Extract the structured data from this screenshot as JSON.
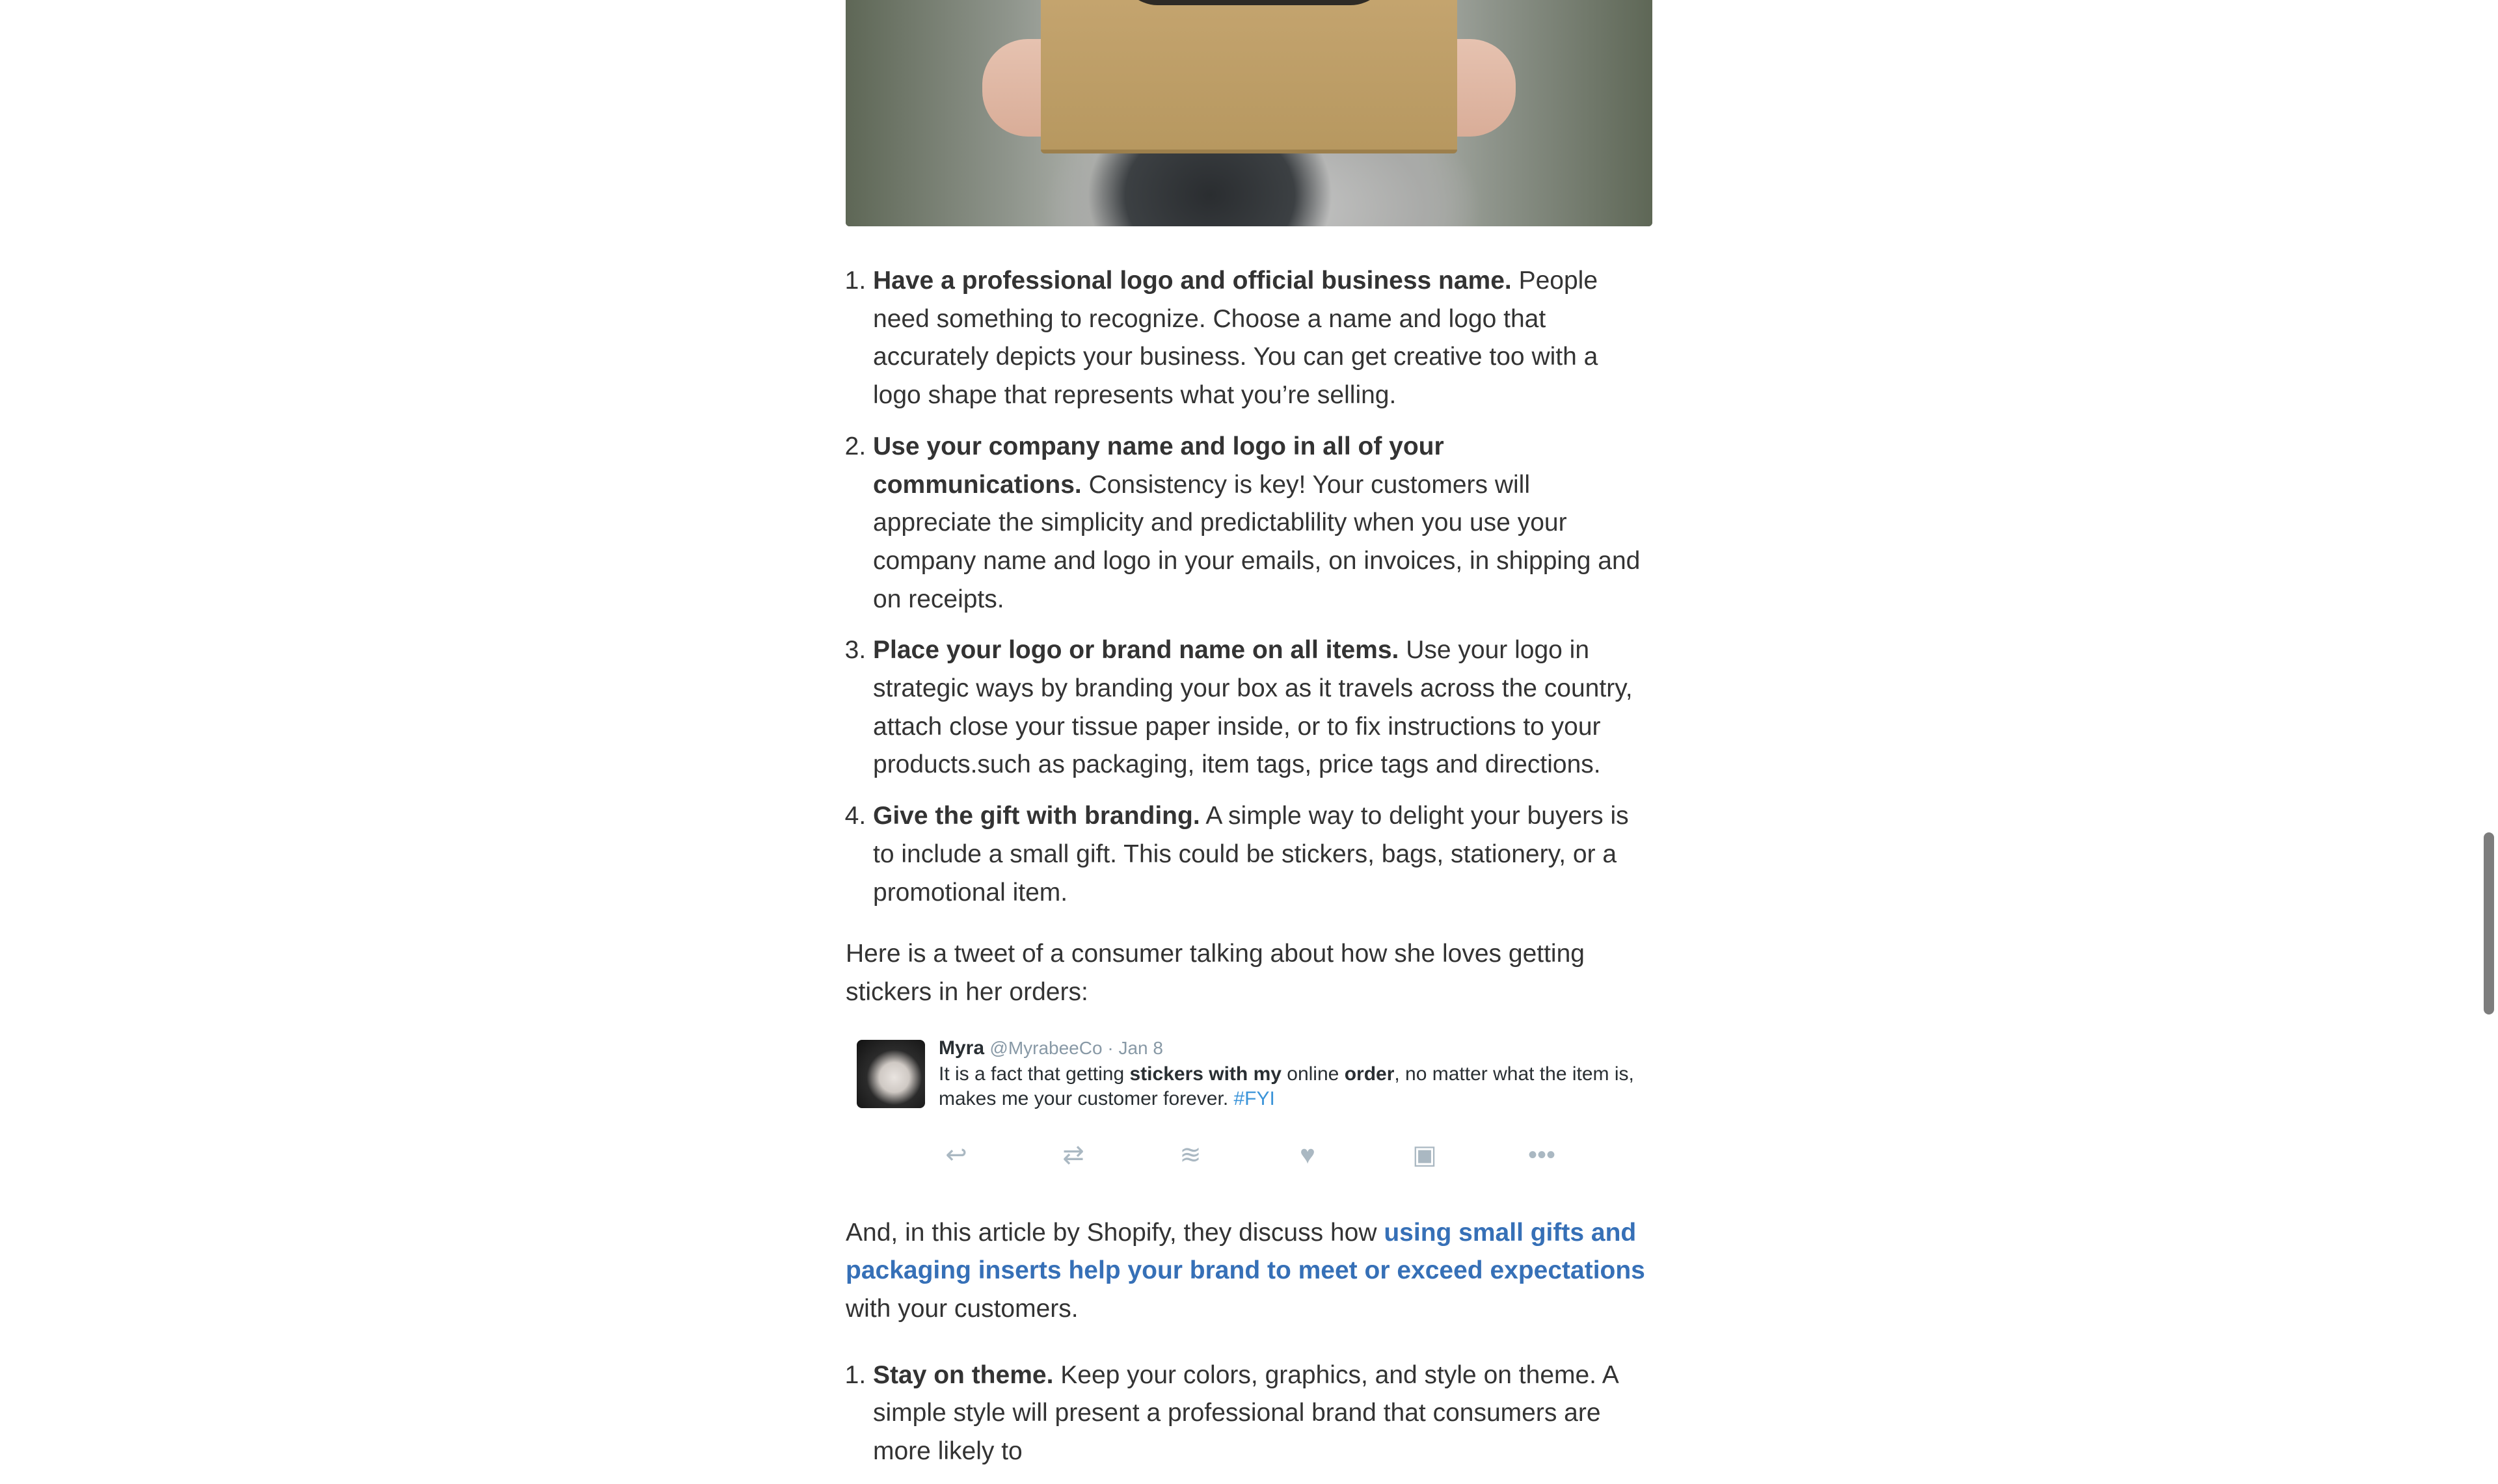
{
  "hero_image": {
    "icon": "hands-holding-gift-box-photo"
  },
  "list_one": [
    {
      "number": "1.",
      "bold": "Have a professional logo and official business name.",
      "text": " People need something to recognize. Choose a name and logo that accurately depicts your business. You can get creative too with a logo shape that represents what you’re selling."
    },
    {
      "number": "2.",
      "bold": "Use your company name and logo in all of your communications.",
      "text": " Consistency is key! Your customers will appreciate the simplicity and predictablility when you use your company name and logo in your emails, on invoices, in shipping and on receipts."
    },
    {
      "number": "3.",
      "bold": "Place your logo or brand name on all items.",
      "text": " Use your logo in strategic ways by branding your box as it travels across the country, attach close your tissue paper inside, or to fix instructions to your products.such as packaging, item tags, price tags and directions."
    },
    {
      "number": "4.",
      "bold": "Give the gift with branding.",
      "text": " A simple way to delight your buyers is to include a small gift. This could be stickers, bags, stationery, or a promotional item."
    }
  ],
  "tweet_intro": "Here is a tweet of a consumer talking about how she loves getting stickers in her orders:",
  "tweet": {
    "name": "Myra",
    "handle": "@MyrabeeCo",
    "separator": " · ",
    "date": "Jan 8",
    "text_1": "It is a fact that getting ",
    "text_bold_1": "stickers with my",
    "text_2": " online ",
    "text_bold_2": "order",
    "text_3": ", no matter what the item is, makes me your customer forever. ",
    "hashtag": "#FYI",
    "actions": [
      {
        "name": "reply-icon",
        "glyph": "↩"
      },
      {
        "name": "retweet-icon",
        "glyph": "⇄"
      },
      {
        "name": "buffer-icon",
        "glyph": "≋"
      },
      {
        "name": "like-icon",
        "glyph": "♥"
      },
      {
        "name": "save-icon",
        "glyph": "▣"
      },
      {
        "name": "more-icon",
        "glyph": "•••"
      }
    ]
  },
  "shopify_para": {
    "before": "And, in this article by Shopify, they discuss how ",
    "link": "using small gifts and packaging inserts help your brand to meet or exceed expectations",
    "after": " with your customers."
  },
  "list_two": [
    {
      "number": "1.",
      "bold": "Stay on theme.",
      "text": " Keep your colors, graphics, and style on theme. A simple style will present a professional brand that consumers are more likely to"
    }
  ],
  "colors": {
    "link": "#3670b7",
    "text": "#333333",
    "tweet_meta": "#8899a6",
    "hashtag": "#3b94d9"
  }
}
